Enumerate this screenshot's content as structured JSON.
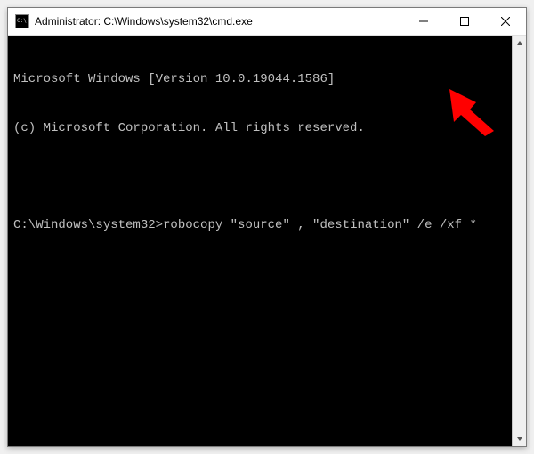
{
  "window": {
    "title": "Administrator: C:\\Windows\\system32\\cmd.exe"
  },
  "console": {
    "version_line": "Microsoft Windows [Version 10.0.19044.1586]",
    "copyright_line": "(c) Microsoft Corporation. All rights reserved.",
    "prompt": "C:\\Windows\\system32>",
    "command": "robocopy \"source\" , \"destination\" /e /xf *"
  },
  "annotation": {
    "arrow_color": "#ff0000"
  }
}
